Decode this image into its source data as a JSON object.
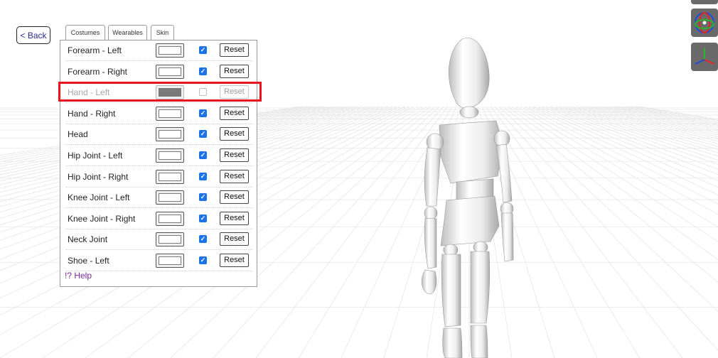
{
  "nav": {
    "back_label": "< Back"
  },
  "tabs": [
    {
      "label": "Costumes",
      "active": false
    },
    {
      "label": "Wearables",
      "active": false
    },
    {
      "label": "Skin",
      "active": true
    }
  ],
  "skin_rows": [
    {
      "label": "Forearm - Left",
      "color": "#ffffff",
      "checked": true,
      "reset": "Reset"
    },
    {
      "label": "Forearm - Right",
      "color": "#ffffff",
      "checked": true,
      "reset": "Reset"
    },
    {
      "label": "Hand - Left",
      "color": "#7a7a7a",
      "checked": false,
      "reset": "Reset"
    },
    {
      "label": "Hand - Right",
      "color": "#ffffff",
      "checked": true,
      "reset": "Reset"
    },
    {
      "label": "Head",
      "color": "#ffffff",
      "checked": true,
      "reset": "Reset"
    },
    {
      "label": "Hip Joint - Left",
      "color": "#ffffff",
      "checked": true,
      "reset": "Reset"
    },
    {
      "label": "Hip Joint - Right",
      "color": "#ffffff",
      "checked": true,
      "reset": "Reset"
    },
    {
      "label": "Knee Joint - Left",
      "color": "#ffffff",
      "checked": true,
      "reset": "Reset"
    },
    {
      "label": "Knee Joint - Right",
      "color": "#ffffff",
      "checked": true,
      "reset": "Reset"
    },
    {
      "label": "Neck Joint",
      "color": "#ffffff",
      "checked": true,
      "reset": "Reset"
    },
    {
      "label": "Shoe - Left",
      "color": "#ffffff",
      "checked": true,
      "reset": "Reset"
    }
  ],
  "help_label": "!? Help",
  "tools": [
    {
      "icon": "rotate-gizmo-icon"
    },
    {
      "icon": "axes-gizmo-icon"
    }
  ],
  "colors": {
    "accent": "#1a73e8",
    "highlight": "#e8141e",
    "help": "#7a2a9a",
    "disabled_swatch": "#7a7a7a"
  }
}
